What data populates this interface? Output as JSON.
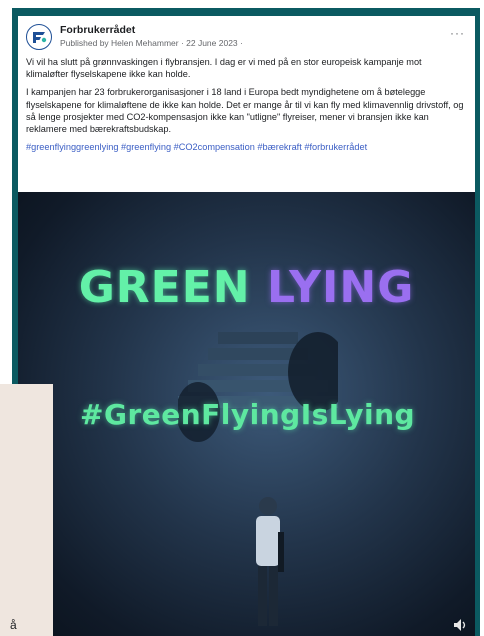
{
  "post": {
    "author": "Forbrukerrådet",
    "meta": "Published by Helen Mehammer · 22 June 2023 ·",
    "more_label": "···",
    "paragraph1": "Vi vil ha slutt på grønnvaskingen i flybransjen. I dag er vi med på en stor europeisk kampanje mot klimaløfter flyselskapene ikke kan holde.",
    "paragraph2": "I kampanjen har 23 forbrukerorganisasjoner i 18 land i Europa bedt myndighetene om å bøtelegge flyselskapene for klimaløftene de ikke kan holde. Det er mange år til vi kan fly med klimavennlig drivstoff, og så lenge prosjekter med CO2-kompensasjon ikke kan \"utligne\" flyreiser, mener vi bransjen ikke kan reklamere med bærekraftsbudskap.",
    "hashtags": "#greenflyinggreenlying #greenflying #CO2compensation #bærekraft #forbrukerrådet"
  },
  "video": {
    "title_green": "GREEN",
    "title_purple": "LYING",
    "hashtag": "#GreenFlyingIsLying",
    "volume_icon": "volume-icon"
  },
  "overlay": {
    "corner_text": "å"
  },
  "colors": {
    "frame": "#0b5a61",
    "hashtag_link": "#3b5ec4",
    "neon_green": "#63f1a8",
    "neon_purple": "#9a6ff0",
    "panel": "#efe6df"
  }
}
